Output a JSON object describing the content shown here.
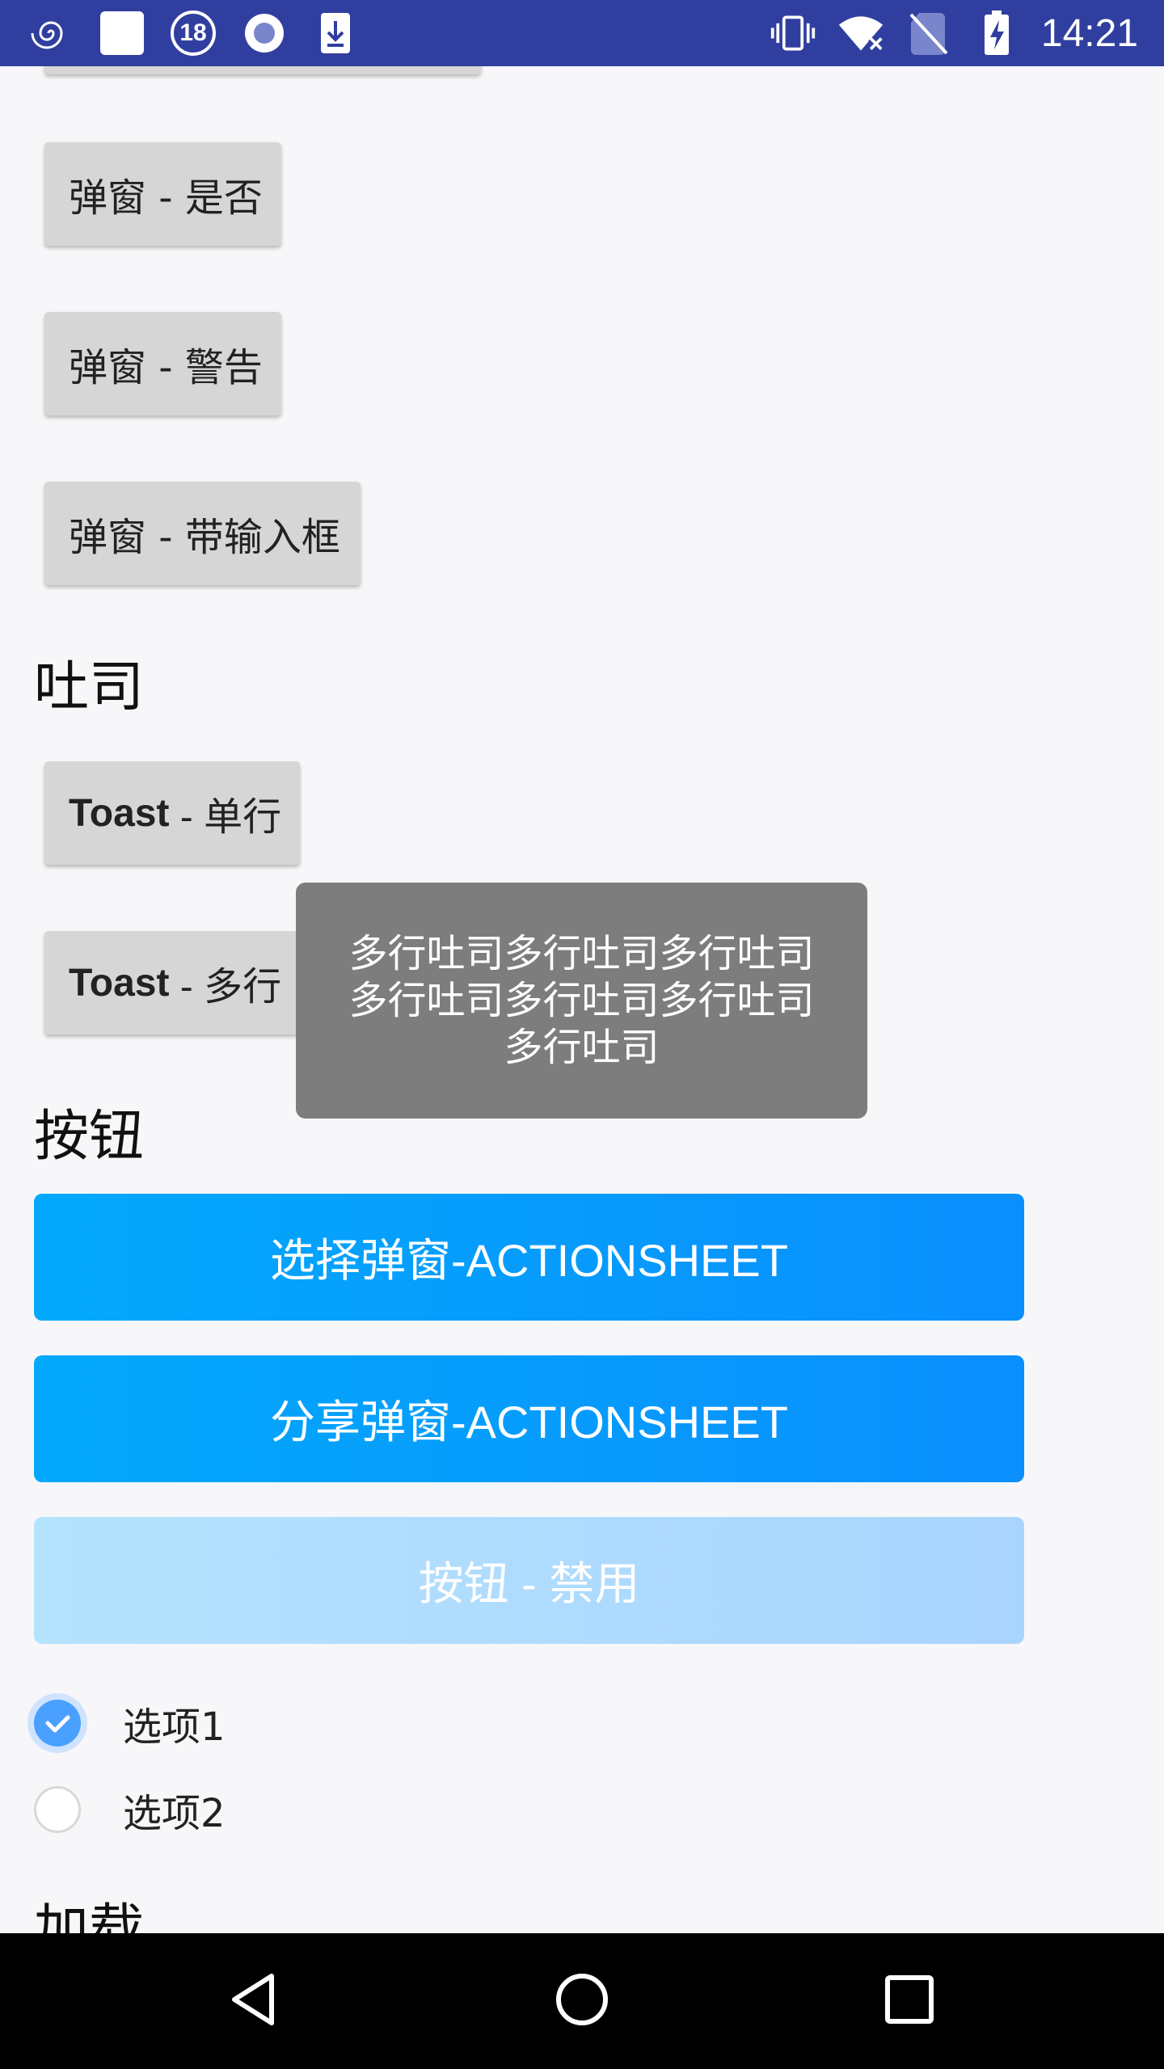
{
  "statusbar": {
    "notification_count": "18",
    "time": "14:21"
  },
  "dialogs": {
    "yes_no_label": "弹窗 - 是否",
    "alert_label": "弹窗 - 警告",
    "input_label": "弹窗 - 带输入框"
  },
  "toast_section": {
    "title": "吐司",
    "single_prefix": "Toast",
    "single_suffix": " - 单行",
    "multi_prefix": "Toast",
    "multi_suffix": " - 多行"
  },
  "toast_popup": {
    "text": "多行吐司多行吐司多行吐司多行吐司多行吐司多行吐司多行吐司"
  },
  "button_section": {
    "title": "按钮",
    "select_sheet_label": "选择弹窗-ACTIONSHEET",
    "share_sheet_label": "分享弹窗-ACTIONSHEET",
    "disabled_label": "按钮 - 禁用"
  },
  "radio_options": [
    {
      "label": "选项1",
      "checked": true
    },
    {
      "label": "选项2",
      "checked": false
    }
  ],
  "loading_section": {
    "title": "加载"
  },
  "colors": {
    "status_bar": "#303f9f",
    "primary_button": "#0a9cfd",
    "disabled_button": "#b0dcfe",
    "toast_bg": "#7d7d7d",
    "radio_checked": "#4aa0ff"
  }
}
